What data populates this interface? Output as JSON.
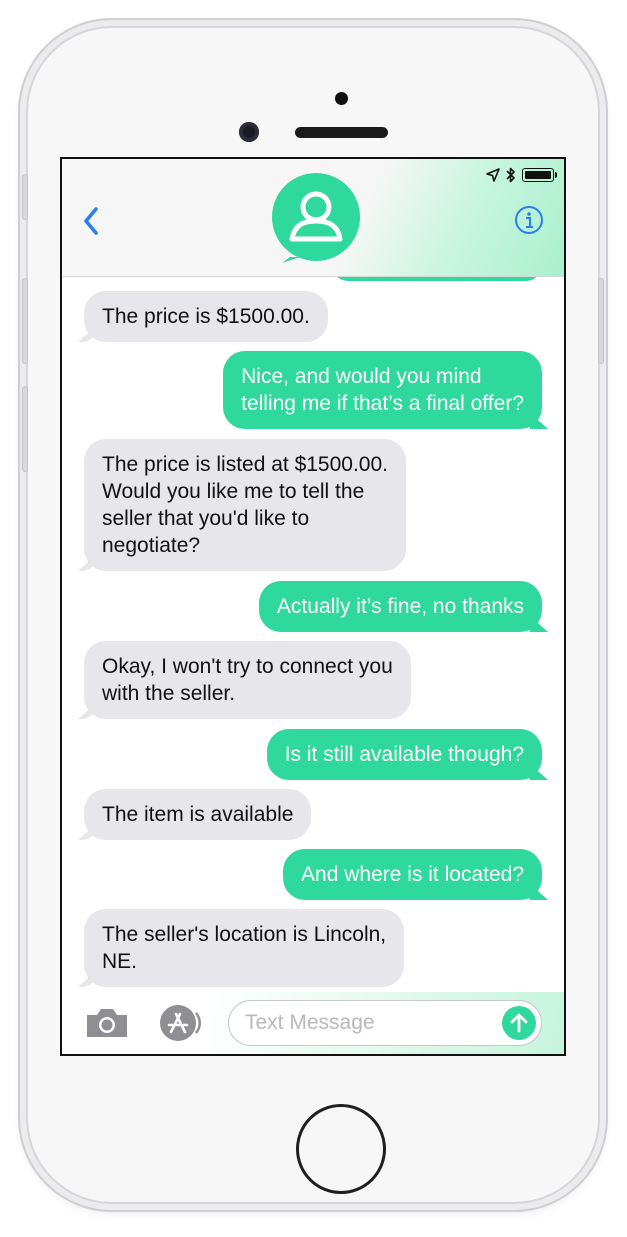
{
  "app": {
    "accent_color": "#2fd89c",
    "incoming_bubble_color": "#e6e6eb",
    "link_color": "#2a7ff0"
  },
  "nav": {
    "back_icon": "chevron-left-icon",
    "avatar_icon": "person-avatar-icon",
    "info_icon": "info-circle-icon"
  },
  "status_bar": {
    "icons": [
      "location-arrow-icon",
      "bluetooth-icon",
      "battery-icon"
    ]
  },
  "messages": [
    {
      "direction": "in",
      "text": "The price is $1500.00."
    },
    {
      "direction": "out",
      "text": "Nice, and would you mind\ntelling me if that’s a final offer?"
    },
    {
      "direction": "in",
      "text": "The price is listed at $1500.00.\nWould you like me to tell the\nseller that you'd like to\nnegotiate?"
    },
    {
      "direction": "out",
      "text": "Actually it’s fine, no thanks"
    },
    {
      "direction": "in",
      "text": "Okay, I won't try to connect you\nwith the seller."
    },
    {
      "direction": "out",
      "text": "Is it still available though?"
    },
    {
      "direction": "in",
      "text": "The item is available"
    },
    {
      "direction": "out",
      "text": "And where is it located?"
    },
    {
      "direction": "in",
      "text": "The seller's location is Lincoln,\nNE."
    }
  ],
  "input": {
    "placeholder": "Text Message",
    "value": ""
  }
}
